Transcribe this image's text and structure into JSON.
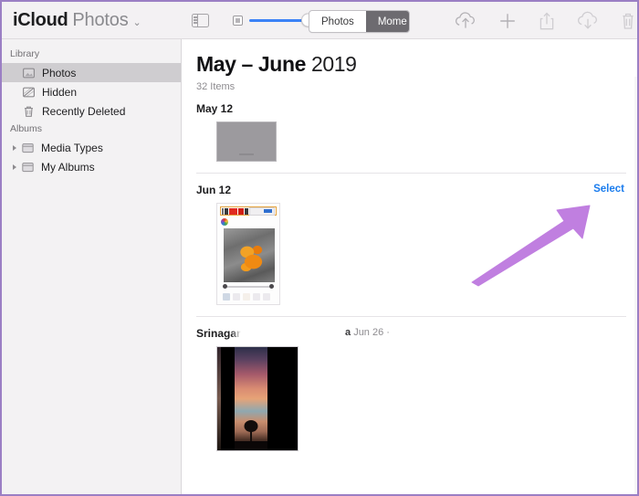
{
  "window": {
    "accent_border": "#9b7fc4",
    "toolbar_bg": "#f3f1f3",
    "sidebar_bg": "#f3f2f3",
    "link_color": "#1a7ced",
    "annotation_color": "#c07fe0"
  },
  "toolbar": {
    "brand_primary": "iCloud",
    "brand_secondary": "Photos",
    "brand_chevron": "⌄",
    "sidebar_toggle_name": "sidebar-toggle",
    "zoom_slider": {
      "small_icon": "small-thumbnail-icon",
      "large_icon": "large-thumbnail-icon",
      "value": 85
    },
    "segments": [
      {
        "label": "Photos",
        "active": false
      },
      {
        "label": "Mome",
        "active": true
      }
    ],
    "actions": [
      {
        "name": "upload-icon",
        "label": "Upload"
      },
      {
        "name": "add-icon",
        "label": "Add"
      },
      {
        "name": "share-icon",
        "label": "Share"
      },
      {
        "name": "download-icon",
        "label": "Download"
      },
      {
        "name": "delete-icon",
        "label": "Delete"
      }
    ]
  },
  "sidebar": {
    "groups": [
      {
        "title": "Library",
        "items": [
          {
            "label": "Photos",
            "icon": "photos-icon",
            "selected": true,
            "arrow": false
          },
          {
            "label": "Hidden",
            "icon": "hidden-icon",
            "selected": false,
            "arrow": false
          },
          {
            "label": "Recently Deleted",
            "icon": "trash-icon",
            "selected": false,
            "arrow": false
          }
        ]
      },
      {
        "title": "Albums",
        "items": [
          {
            "label": "Media Types",
            "icon": "folder-icon",
            "selected": false,
            "arrow": true
          },
          {
            "label": "My Albums",
            "icon": "folder-icon",
            "selected": false,
            "arrow": true
          }
        ]
      }
    ]
  },
  "main": {
    "title_strong": "May – June",
    "title_year": "2019",
    "item_count": "32 Items",
    "sections": [
      {
        "title": "May 12",
        "meta": "",
        "meta_lead": "",
        "select_label": "",
        "thumb": "placeholder"
      },
      {
        "title": "Jun 12",
        "meta": "",
        "meta_lead": "",
        "select_label": "Select",
        "thumb": "editor-screenshot"
      },
      {
        "title": "Srinagar",
        "meta_lead": "a",
        "meta": "Jun 26  ·",
        "select_label": "",
        "thumb": "sunset-photo"
      }
    ]
  },
  "annotation": {
    "name": "purple-arrow-annotation",
    "points_to": "Select"
  }
}
